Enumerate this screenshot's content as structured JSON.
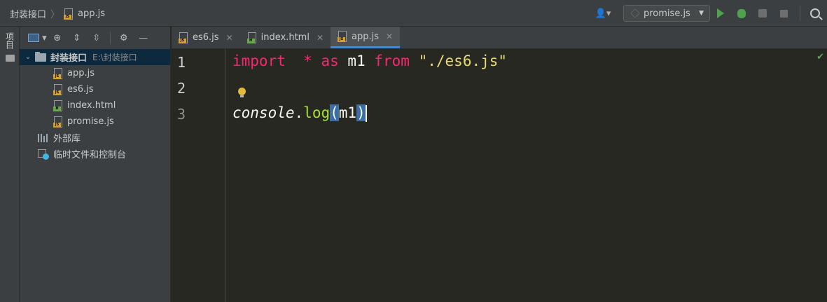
{
  "breadcrumb": {
    "project": "封装接口",
    "file": "app.js"
  },
  "toolbar": {
    "run_config": "promise.js"
  },
  "toolstrip": {
    "project_tab": "项目"
  },
  "project_panel": {
    "root_name": "封装接口",
    "root_path": "E:\\封装接口",
    "files": [
      "app.js",
      "es6.js",
      "index.html",
      "promise.js"
    ],
    "external_libraries": "外部库",
    "scratches": "临时文件和控制台"
  },
  "tabs": [
    {
      "label": "es6.js",
      "type": "js"
    },
    {
      "label": "index.html",
      "type": "html"
    },
    {
      "label": "app.js",
      "type": "js",
      "active": true
    }
  ],
  "editor": {
    "line_numbers": [
      "1",
      "2",
      "3"
    ],
    "line1": {
      "kw_import": "import",
      "star": "*",
      "kw_as": "as",
      "ident": "m1",
      "kw_from": "from",
      "string": "\"./es6.js\""
    },
    "line3": {
      "obj": "console",
      "dot": ".",
      "method": "log",
      "open": "(",
      "arg": "m1",
      "close": ")"
    }
  }
}
